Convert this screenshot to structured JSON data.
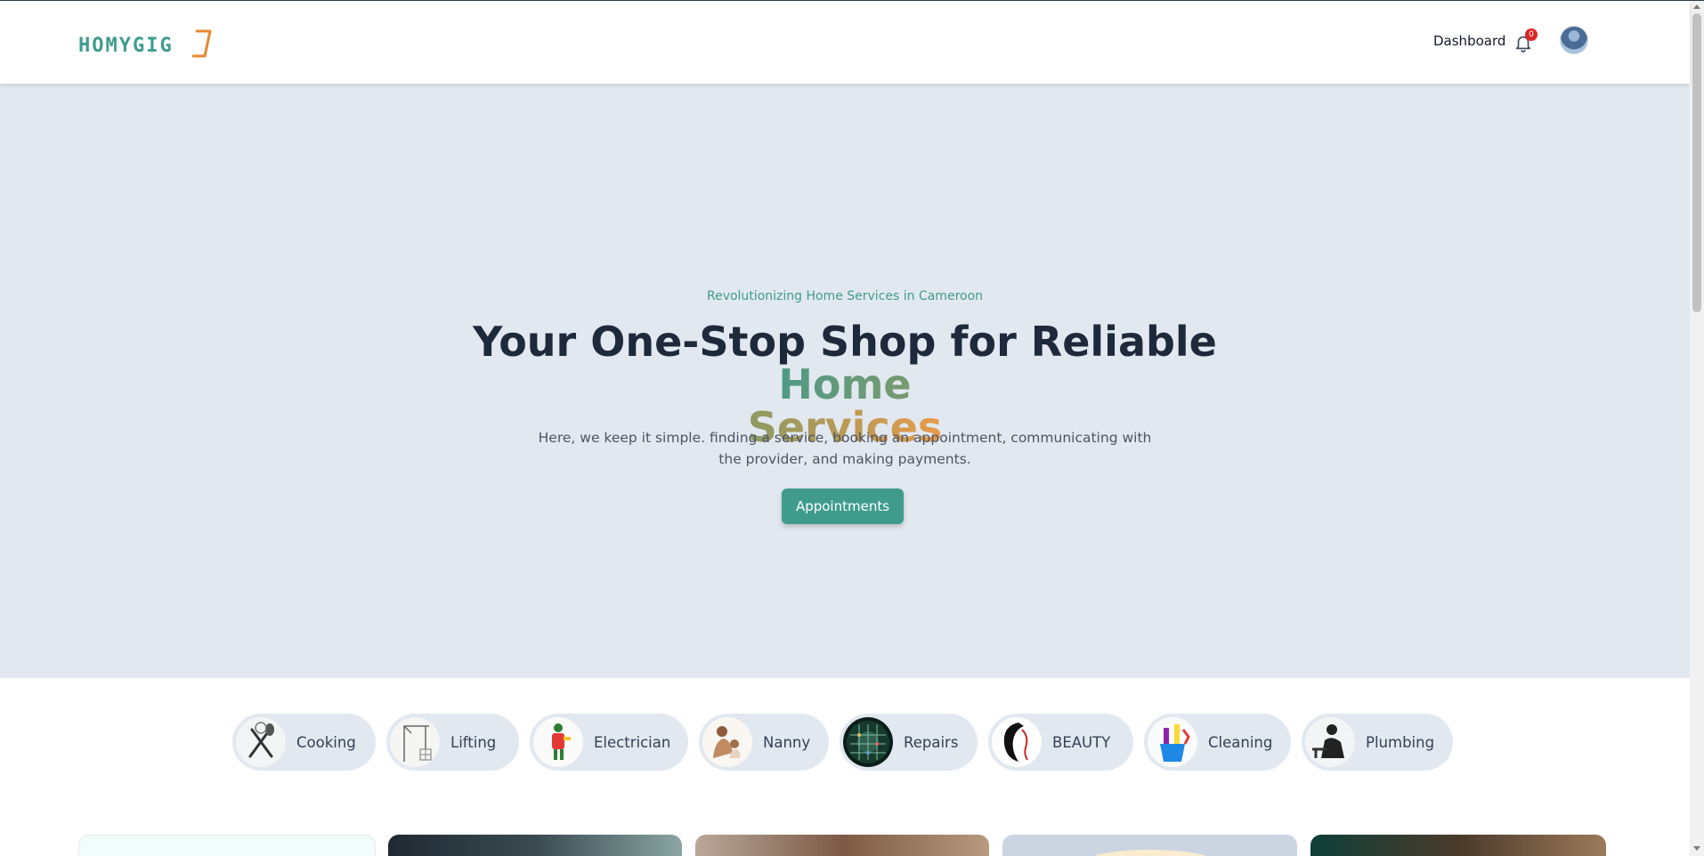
{
  "header": {
    "logo_text": "HOMYGIG",
    "dashboard_label": "Dashboard",
    "notification_count": "0",
    "bell_icon": "bell-icon",
    "avatar_icon": "user-avatar"
  },
  "hero": {
    "tagline": "Revolutionizing Home Services in Cameroon",
    "title_part1": "Your One-Stop Shop for Reliable ",
    "title_home": "Home",
    "title_services": "Services",
    "description": "Here, we keep it simple. finding a service, booking an appointment, communicating with the provider, and making payments.",
    "cta_label": "Appointments"
  },
  "categories": [
    {
      "label": "Cooking",
      "icon": "cooking-utensils-icon"
    },
    {
      "label": "Lifting",
      "icon": "crane-icon"
    },
    {
      "label": "Electrician",
      "icon": "electrician-icon"
    },
    {
      "label": "Nanny",
      "icon": "nanny-icon"
    },
    {
      "label": "Repairs",
      "icon": "circuit-board-icon"
    },
    {
      "label": "BEAUTY",
      "icon": "beauty-icon"
    },
    {
      "label": "Cleaning",
      "icon": "cleaning-supplies-icon"
    },
    {
      "label": "Plumbing",
      "icon": "plumber-icon"
    }
  ],
  "colors": {
    "brand_teal": "#3f9c8c",
    "accent_orange": "#e89a4a",
    "hero_bg": "#e2e8f0",
    "badge_red": "#dc2626"
  }
}
